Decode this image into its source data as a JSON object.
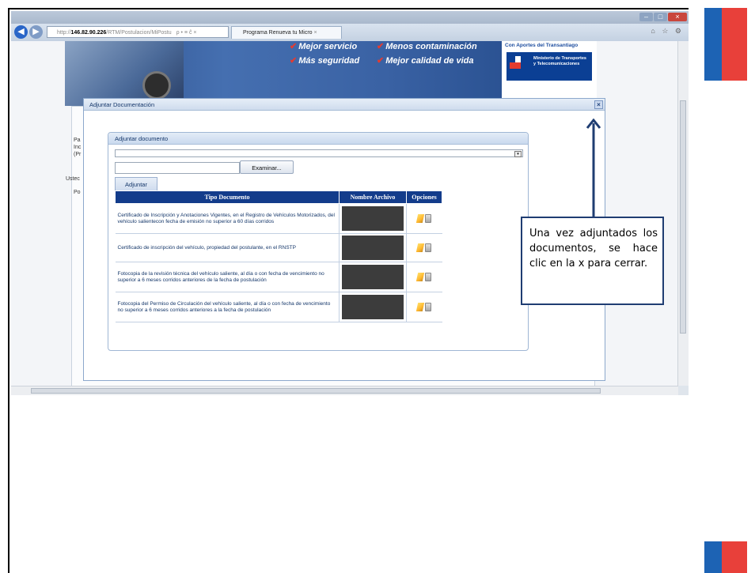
{
  "browser": {
    "address_prefix": "http://",
    "address_domain": "146.82.90.226",
    "address_path": "/RTM/Postulacion/MiPostu",
    "address_controls": "ρ • ≡ ĉ ×",
    "tab_label": "Programa Renueva tu Micro",
    "toolbar_icons": "⌂ ☆ ⚙"
  },
  "banner": {
    "slogan_1": "Mejor servicio",
    "slogan_2": "Menos contaminación",
    "slogan_3": "Más seguridad",
    "slogan_4": "Mejor calidad de vida",
    "ministry_caption": "Con Aportes del Transantiago",
    "ministry_name": "Ministerio de Transportes y Telecomunicaciones"
  },
  "background_text": {
    "line_1": "Pa",
    "line_2": "Inc",
    "line_3": "(Pr",
    "line_4": "Ustec",
    "line_5": "Po"
  },
  "dialog": {
    "title": "Adjuntar Documentación",
    "close_label": "×",
    "inner_title": "Adjuntar documento",
    "browse_label": "Examinar...",
    "attach_tab": "Adjuntar",
    "select_arrow": "▾"
  },
  "table": {
    "headers": [
      "Tipo Documento",
      "Nombre Archivo",
      "Opciones"
    ],
    "rows": [
      {
        "tipo": "Certificado de Inscripción y Anotaciones Vigentes, en el Registro de Vehículos Motorizados, del vehículo salientecon fecha de emisión no superior a 60 días corridos"
      },
      {
        "tipo": "Certificado de inscripción del vehículo, propiedad del postulante, en el RNSTP"
      },
      {
        "tipo": "Fotocopia de la revisión técnica del vehículo saliente, al día o con fecha de vencimiento no superior a 6 meses corridos anteriores de la fecha de postulación"
      },
      {
        "tipo": "Fotocopia del Permiso de Circulación del vehículo saliente, al día o con fecha de vencimiento no superior a 6 meses corridos anteriores a la fecha de postulación"
      }
    ]
  },
  "callout": {
    "text": "Una vez adjuntados los documentos, se hace clic en la x para cerrar."
  },
  "colors": {
    "header_blue": "#133c8b",
    "callout_border": "#1f3d72",
    "flag_blue": "#1d63b4",
    "flag_red": "#e8403a"
  },
  "icons": {
    "edit": "pencil-edit-icon",
    "delete": "trash-icon"
  }
}
